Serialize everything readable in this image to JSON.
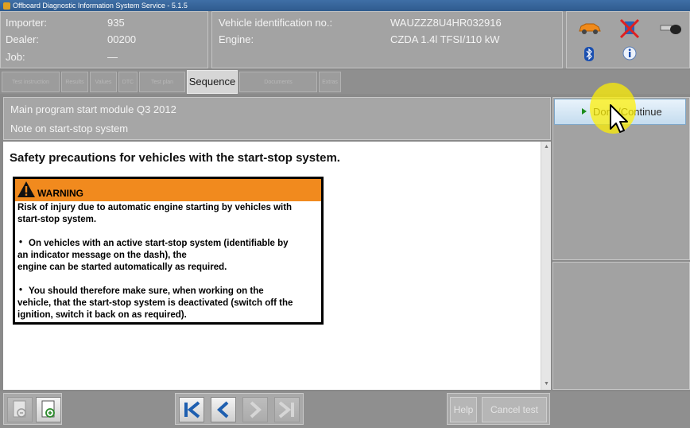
{
  "window": {
    "title": "Offboard Diagnostic Information System Service - 5.1.5"
  },
  "header": {
    "importer_label": "Importer:",
    "importer_value": "935",
    "dealer_label": "Dealer:",
    "dealer_value": "00200",
    "job_label": "Job:",
    "job_value": "—",
    "vin_label": "Vehicle identification no.:",
    "vin_value": "WAUZZZ8U4HR032916",
    "engine_label": "Engine:",
    "engine_value": "CZDA 1.4l TFSI/110 kW",
    "icons": [
      "car-icon",
      "disconnected-icon",
      "key-icon",
      "bluetooth-icon",
      "info-icon"
    ]
  },
  "tabs": [
    {
      "label": "Test instruction"
    },
    {
      "label": "Results"
    },
    {
      "label": "Values"
    },
    {
      "label": "DTC"
    },
    {
      "label": "Test plan"
    },
    {
      "label": "Sequence"
    },
    {
      "label": "Documents"
    },
    {
      "label": "Extras"
    }
  ],
  "main": {
    "module_title": "Main program start module Q3 2012",
    "subtitle": "Note on start-stop system",
    "heading": "Safety precautions for vehicles with the start-stop system.",
    "warning": {
      "title": "WARNING",
      "lines": [
        "Risk of injury due to automatic engine starting by vehicles with",
        "start-stop system.",
        "On vehicles with an active start-stop system (identifiable by",
        "an indicator message on the dash), the",
        "engine can be started automatically as required.",
        "You should therefore make sure, when working on the",
        "vehicle, that the start-stop system is deactivated (switch off the",
        "ignition, switch it back on as required)."
      ],
      "bullet": "•"
    }
  },
  "side": {
    "done_label": "Done/Continue"
  },
  "bottom": {
    "help_label": "Help",
    "cancel_label": "Cancel test"
  },
  "colors": {
    "warning_header": "#f18a1e",
    "done_button": "#d6e7f5",
    "play_icon": "#1d8d1d",
    "nav_arrow": "#1e5fb0"
  }
}
